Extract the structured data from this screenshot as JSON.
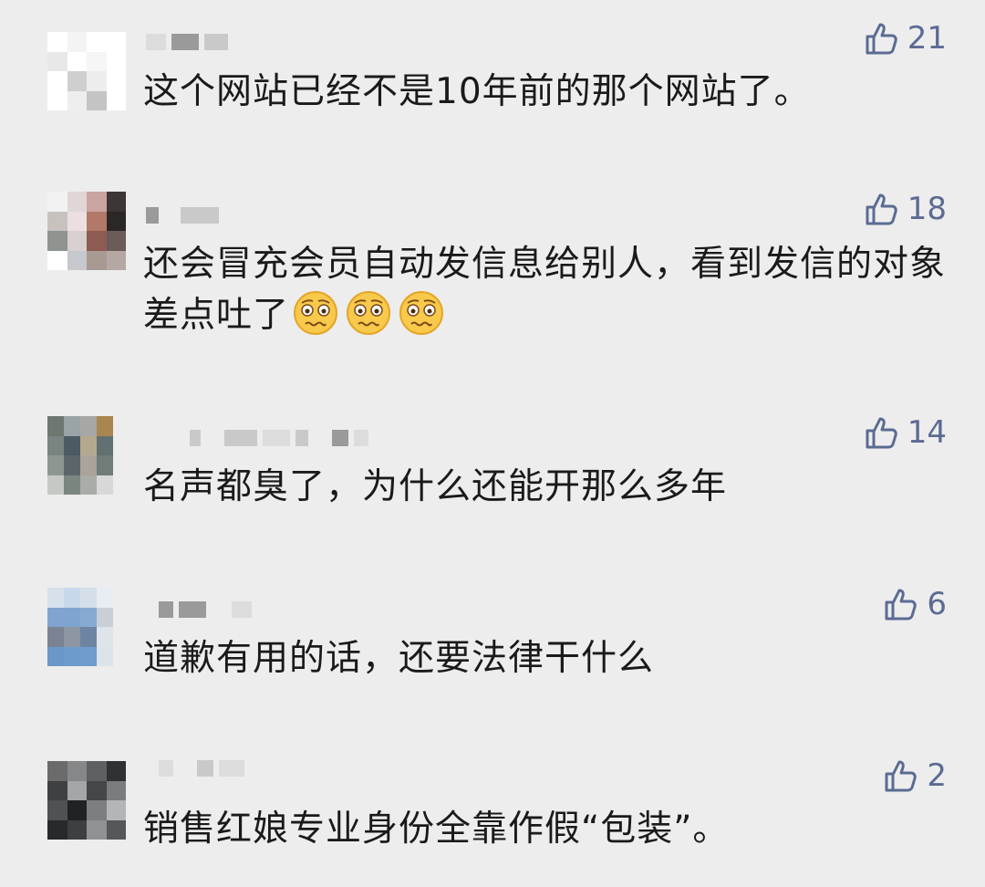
{
  "comments": [
    {
      "text": "这个网站已经不是10年前的那个网站了。",
      "likes": "21",
      "like_icon": "thumbs-up-outline",
      "avatar_colors": [
        "#ffffff",
        "#f4f4f4",
        "#ffffff",
        "#ffffff",
        "#e8e8e8",
        "#ffffff",
        "#f6f6f6",
        "#ffffff",
        "#ffffff",
        "#cfcfcf",
        "#ededed",
        "#ffffff",
        "#ffffff",
        "#eeeeee",
        "#c4c4c4",
        "#ffffff"
      ]
    },
    {
      "text": "还会冒充会员自动发信息给别人，看到发信的对象差点吐了",
      "likes": "18",
      "like_icon": "thumbs-up-outline",
      "emoji": "woozy-face",
      "emoji_count": 3,
      "avatar_colors": [
        "#f2f2f2",
        "#e0d6d6",
        "#c9a4a0",
        "#3c3634",
        "#c8c2be",
        "#ecdfe1",
        "#b27868",
        "#2b2726",
        "#8f9491",
        "#d8cfcf",
        "#8c5b51",
        "#6a5a58",
        "#ffffff",
        "#c7c7ce",
        "#a99993",
        "#b5a7a4"
      ]
    },
    {
      "text": "名声都臭了，为什么还能开那么多年",
      "likes": "14",
      "like_icon": "thumbs-up-outline",
      "avatar_colors": [
        "#6e7770",
        "#9aa3a5",
        "#a7a7a5",
        "#a9864f",
        "#7a8480",
        "#4c5a63",
        "#b4a98f",
        "#617070",
        "#8d978f",
        "#5a6669",
        "#a9a39a",
        "#6f7c78",
        "#c5c9c6",
        "#7b8680",
        "#a9aca7",
        "#d8d8d8"
      ]
    },
    {
      "text": "道歉有用的话，还要法律干什么",
      "likes": "6",
      "like_icon": "thumbs-up-outline",
      "avatar_colors": [
        "#d7e1ec",
        "#c8d7ea",
        "#d4dfea",
        "#e7edf3",
        "#80a4cf",
        "#7fa4cf",
        "#87aad2",
        "#c8cfd6",
        "#7b8393",
        "#8d96a3",
        "#6d84a2",
        "#dfe4ea",
        "#6a97c7",
        "#6d9bcb",
        "#6f9ccc",
        "#dde3ea"
      ]
    },
    {
      "text": "销售红娘专业身份全靠作假“包装”。",
      "likes": "2",
      "like_icon": "thumbs-up-outline",
      "avatar_colors": [
        "#6a6b6a",
        "#868788",
        "#5e6062",
        "#2f3234",
        "#3f4042",
        "#a5a6a8",
        "#454647",
        "#7b7c7e",
        "#4f5153",
        "#202326",
        "#7c7e81",
        "#b4b5b7",
        "#28292b",
        "#3d3f42",
        "#8f9193",
        "#55575a"
      ]
    }
  ]
}
